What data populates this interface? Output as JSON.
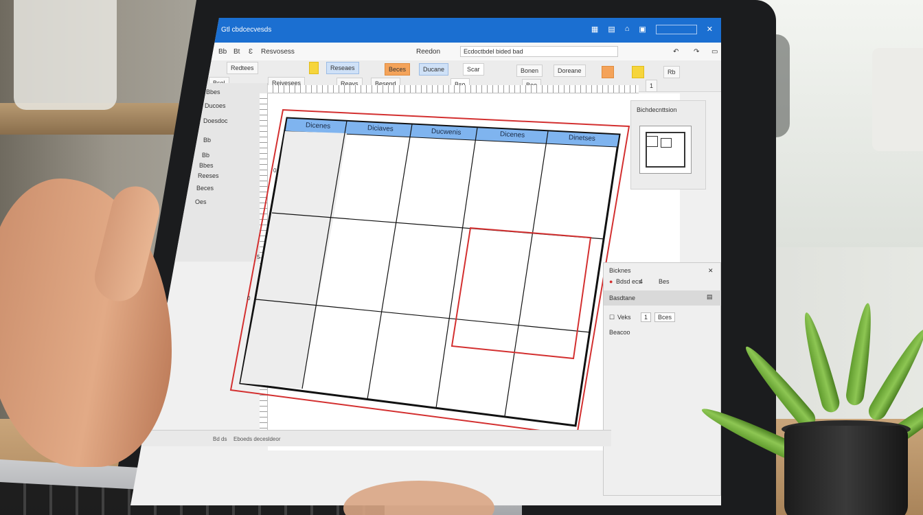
{
  "app": {
    "title": "Gtl cbdcecvesds",
    "search_placeholder": ""
  },
  "menubar": {
    "items": [
      "Bb",
      "Bt",
      "Ɛ",
      "Resvosess"
    ],
    "doc_label": "Reedon",
    "doc_name": "Ecdoctbdel bided bad"
  },
  "toolbar": {
    "row1": [
      "Redtees",
      "Reseaes",
      "Beces",
      "Ducane",
      "Scar",
      "Bonen"
    ],
    "row2": [
      "Bsol",
      "Reivesees",
      "Reavs",
      "Besend",
      "Bso",
      "Boe",
      "Doreane",
      "Rb"
    ],
    "zoom": "1"
  },
  "left_panel": {
    "items": [
      "Bbes",
      "Ducoes",
      "Doesdoc",
      "Bbes",
      "Reeses",
      "Beces",
      "Oes"
    ],
    "field1": "Bb",
    "field2": "Bb"
  },
  "table": {
    "headers": [
      "Dicenes",
      "Diciaves",
      "Ducwenis",
      "Dicenes",
      "Dinetses"
    ],
    "row_labels": [
      "0",
      "5",
      "0"
    ]
  },
  "right_panel": {
    "title": "Bichdecnttsion"
  },
  "properties": {
    "title": "Bicknes",
    "row1": "Bdsd ecs",
    "row1_value": "4",
    "row1_tail": "Bes",
    "section": "Basdtane",
    "field_label": "Veks",
    "field_value": "1",
    "field_unit": "Bces",
    "row3": "Beacoo"
  },
  "statusbar": {
    "left": "Bd ds",
    "center": "Eboeds decesldeor"
  },
  "colors": {
    "accent": "#1b6fd1",
    "table_header": "#7fb4ef",
    "highlight": "#d32f2f"
  }
}
